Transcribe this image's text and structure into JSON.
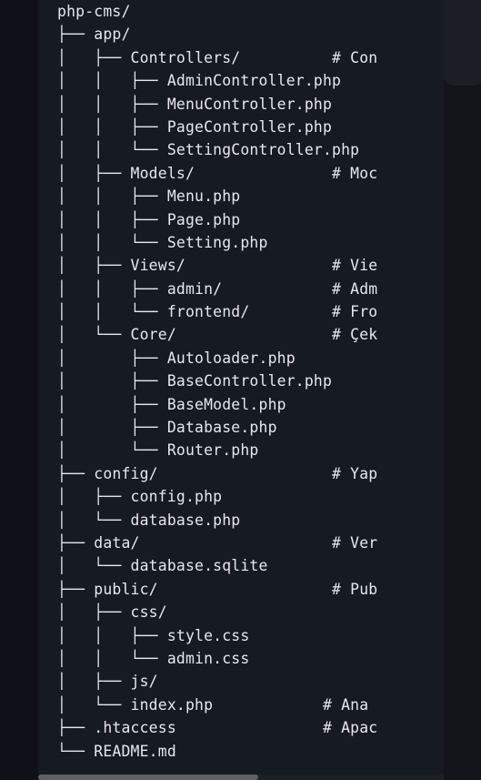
{
  "code_block": {
    "lines": [
      "php-cms/",
      "├── app/",
      "│   ├── Controllers/          # Con",
      "│   │   ├── AdminController.php",
      "│   │   ├── MenuController.php",
      "│   │   ├── PageController.php",
      "│   │   └── SettingController.php",
      "│   ├── Models/               # Moc",
      "│   │   ├── Menu.php",
      "│   │   ├── Page.php",
      "│   │   └── Setting.php",
      "│   ├── Views/                # Vie",
      "│   │   ├── admin/            # Adm",
      "│   │   └── frontend/         # Fro",
      "│   └── Core/                 # Çek",
      "│       ├── Autoloader.php",
      "│       ├── BaseController.php",
      "│       ├── BaseModel.php",
      "│       ├── Database.php",
      "│       └── Router.php",
      "├── config/                   # Yap",
      "│   ├── config.php",
      "│   └── database.php",
      "├── data/                     # Ver",
      "│   └── database.sqlite",
      "├── public/                   # Pub",
      "│   ├── css/",
      "│   │   ├── style.css",
      "│   │   └── admin.css",
      "│   ├── js/",
      "│   └── index.php            # Ana",
      "├── .htaccess                # Apac",
      "└── README.md"
    ]
  },
  "icons": {
    "copy": "copy-icon"
  },
  "colors": {
    "background": "#0d1016",
    "code_panel": "#161a21",
    "text": "#e6e8ec",
    "icon": "#8a8f98",
    "scrollbar_thumb": "#5e6066"
  }
}
